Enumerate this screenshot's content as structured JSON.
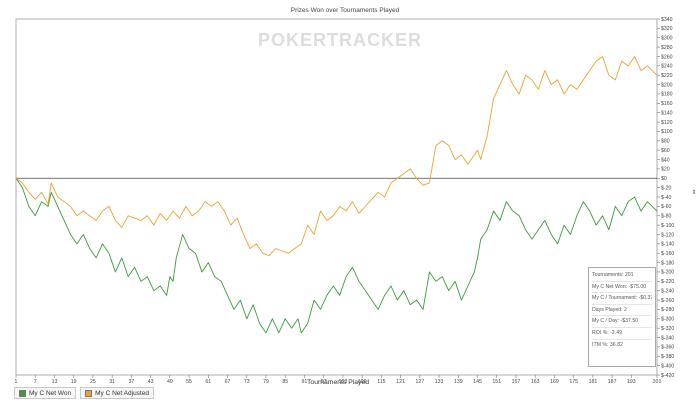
{
  "chart_data": {
    "type": "line",
    "title": "Prizes Won over Tournaments Played",
    "watermark": "POKERTRACKER",
    "xlabel": "Tournaments Played",
    "ylabel": "",
    "xlim": [
      1,
      201
    ],
    "ylim": [
      -420,
      340
    ],
    "x_ticks": [
      1,
      7,
      13,
      19,
      25,
      31,
      37,
      43,
      49,
      55,
      61,
      67,
      73,
      79,
      85,
      91,
      97,
      103,
      109,
      115,
      121,
      127,
      133,
      139,
      145,
      151,
      157,
      163,
      169,
      175,
      181,
      187,
      193,
      201
    ],
    "y_ticks": [
      340,
      320,
      300,
      280,
      260,
      240,
      220,
      200,
      180,
      160,
      140,
      120,
      100,
      80,
      60,
      40,
      20,
      0,
      -20,
      -40,
      -60,
      -80,
      -100,
      -120,
      -140,
      -160,
      -180,
      -200,
      -220,
      -240,
      -260,
      -280,
      -300,
      -320,
      -340,
      -360,
      -380,
      -400,
      -420
    ],
    "y_tick_labels": [
      "$340",
      "$320",
      "$300",
      "$280",
      "$260",
      "$240",
      "$220",
      "$200",
      "$180",
      "$160",
      "$140",
      "$120",
      "$100",
      "$80",
      "$60",
      "$40",
      "$20",
      "$0",
      "$-20",
      "$-40",
      "$-60",
      "$-80",
      "$-100",
      "$-120",
      "$-140",
      "$-160",
      "$-180",
      "$-200",
      "$-220",
      "$-240",
      "$-260",
      "$-280",
      "$-300",
      "$-320",
      "$-340",
      "$-360",
      "$-380",
      "$-400",
      "$-420"
    ],
    "grid": false,
    "legend_position": "bottom-left",
    "series": [
      {
        "name": "My C Net Won",
        "color": "#3a9a3a",
        "x": [
          1,
          3,
          5,
          7,
          9,
          11,
          12,
          14,
          16,
          18,
          20,
          22,
          24,
          26,
          28,
          30,
          32,
          34,
          36,
          38,
          40,
          42,
          44,
          46,
          48,
          49,
          50,
          51,
          53,
          55,
          57,
          59,
          61,
          63,
          65,
          67,
          69,
          71,
          73,
          75,
          77,
          79,
          81,
          83,
          85,
          87,
          89,
          90,
          92,
          94,
          96,
          98,
          100,
          102,
          104,
          106,
          108,
          110,
          112,
          114,
          116,
          118,
          120,
          122,
          124,
          126,
          128,
          130,
          132,
          134,
          136,
          138,
          140,
          142,
          144,
          145,
          146,
          148,
          150,
          152,
          154,
          156,
          158,
          160,
          162,
          164,
          166,
          168,
          170,
          172,
          174,
          176,
          178,
          180,
          182,
          184,
          186,
          188,
          190,
          192,
          194,
          196,
          198,
          201
        ],
        "y": [
          0,
          -20,
          -60,
          -80,
          -50,
          -60,
          -30,
          -60,
          -90,
          -120,
          -140,
          -120,
          -150,
          -170,
          -140,
          -160,
          -200,
          -170,
          -210,
          -190,
          -220,
          -210,
          -240,
          -230,
          -250,
          -210,
          -220,
          -170,
          -120,
          -150,
          -160,
          -200,
          -180,
          -210,
          -220,
          -250,
          -280,
          -260,
          -300,
          -270,
          -310,
          -330,
          -300,
          -330,
          -300,
          -320,
          -300,
          -330,
          -310,
          -260,
          -280,
          -250,
          -230,
          -250,
          -210,
          -190,
          -220,
          -240,
          -260,
          -280,
          -250,
          -230,
          -260,
          -240,
          -270,
          -260,
          -280,
          -200,
          -220,
          -210,
          -240,
          -220,
          -260,
          -230,
          -200,
          -170,
          -130,
          -110,
          -70,
          -90,
          -50,
          -70,
          -80,
          -110,
          -130,
          -110,
          -90,
          -120,
          -140,
          -100,
          -120,
          -80,
          -50,
          -70,
          -100,
          -80,
          -110,
          -60,
          -80,
          -50,
          -40,
          -70,
          -50,
          -70
        ]
      },
      {
        "name": "My C Net Adjusted",
        "color": "#f0a030",
        "x": [
          1,
          3,
          5,
          7,
          9,
          11,
          12,
          14,
          16,
          18,
          20,
          22,
          24,
          26,
          28,
          30,
          32,
          34,
          36,
          38,
          40,
          42,
          44,
          46,
          48,
          50,
          52,
          54,
          56,
          58,
          60,
          62,
          64,
          66,
          68,
          70,
          72,
          74,
          76,
          78,
          80,
          82,
          84,
          86,
          88,
          90,
          92,
          94,
          96,
          98,
          100,
          102,
          104,
          106,
          108,
          110,
          112,
          114,
          116,
          118,
          120,
          122,
          124,
          126,
          128,
          130,
          132,
          134,
          136,
          138,
          140,
          142,
          144,
          145,
          146,
          148,
          150,
          152,
          154,
          156,
          158,
          160,
          162,
          164,
          166,
          168,
          170,
          172,
          174,
          176,
          178,
          180,
          182,
          184,
          186,
          188,
          190,
          192,
          194,
          196,
          198,
          201
        ],
        "y": [
          0,
          -10,
          -30,
          -45,
          -30,
          -55,
          -10,
          -40,
          -50,
          -60,
          -80,
          -70,
          -80,
          -90,
          -70,
          -60,
          -90,
          -105,
          -80,
          -85,
          -90,
          -80,
          -100,
          -75,
          -90,
          -70,
          -85,
          -60,
          -80,
          -70,
          -50,
          -60,
          -50,
          -70,
          -100,
          -85,
          -120,
          -150,
          -140,
          -160,
          -165,
          -150,
          -155,
          -160,
          -150,
          -140,
          -100,
          -120,
          -70,
          -90,
          -80,
          -60,
          -70,
          -50,
          -75,
          -60,
          -45,
          -30,
          -40,
          -10,
          0,
          10,
          20,
          0,
          -15,
          -10,
          70,
          80,
          70,
          40,
          50,
          30,
          50,
          60,
          40,
          90,
          170,
          200,
          230,
          200,
          180,
          220,
          210,
          190,
          230,
          200,
          210,
          180,
          200,
          190,
          210,
          230,
          250,
          260,
          220,
          210,
          250,
          240,
          260,
          230,
          240,
          220
        ]
      }
    ]
  },
  "stats": {
    "tournaments": "Tournaments: 201",
    "net_won": "My C Net Won: -$75.00",
    "per_tournament": "My C / Tournament: -$0.37",
    "days_played": "Days Played: 2",
    "per_day": "My C / Day: -$37.50",
    "roi": "ROI %: -2.49",
    "itm": "ITM %: 36.82"
  },
  "legend": {
    "series1_label": "My C Net Won",
    "series2_label": "My C Net Adjusted",
    "series1_color": "#3a9a3a",
    "series2_color": "#f0a030"
  }
}
